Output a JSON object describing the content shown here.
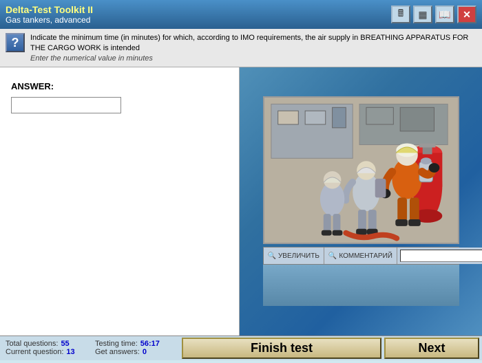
{
  "titleBar": {
    "appTitle": "Delta-Test Toolkit II",
    "appSubtitle": "Gas tankers, advanced",
    "icons": [
      "calculator-icon",
      "spreadsheet-icon",
      "book-icon",
      "close-icon"
    ]
  },
  "question": {
    "text": "Indicate the minimum time (in minutes) for which, according to IMO requirements, the air supply in BREATHING APPARATUS FOR THE CARGO WORK is intended",
    "hint": "Enter the numerical value in minutes"
  },
  "answer": {
    "label": "ANSWER:",
    "placeholder": "",
    "value": ""
  },
  "imageToolbar": {
    "enlargeBtn": "УВЕЛИЧИТЬ",
    "commentBtn": "КОММЕНТАРИЙ",
    "searchPlaceholder": ""
  },
  "bottomBar": {
    "totalQuestionsLabel": "Total questions:",
    "totalQuestionsValue": "55",
    "currentQuestionLabel": "Current question:",
    "currentQuestionValue": "13",
    "testingTimeLabel": "Testing time:",
    "testingTimeValue": "56:17",
    "getAnswersLabel": "Get answers:",
    "getAnswersValue": "0",
    "finishTestBtn": "Finish test",
    "nextBtn": "Next"
  }
}
